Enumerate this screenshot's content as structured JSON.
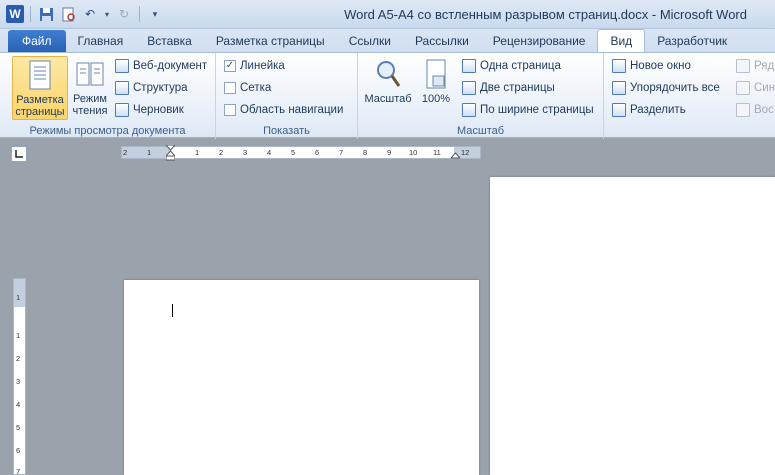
{
  "window": {
    "title": "Word A5-A4 со встленным разрывом страниц.docx  -  Microsoft Word",
    "logo_letter": "W"
  },
  "tabs": [
    {
      "label": "Файл"
    },
    {
      "label": "Главная"
    },
    {
      "label": "Вставка"
    },
    {
      "label": "Разметка страницы"
    },
    {
      "label": "Ссылки"
    },
    {
      "label": "Рассылки"
    },
    {
      "label": "Рецензирование"
    },
    {
      "label": "Вид"
    },
    {
      "label": "Разработчик"
    }
  ],
  "ribbon": {
    "view_modes": {
      "label": "Режимы просмотра документа",
      "print_layout_l1": "Разметка",
      "print_layout_l2": "страницы",
      "reading_l1": "Режим",
      "reading_l2": "чтения",
      "web": "Веб-документ",
      "outline": "Структура",
      "draft": "Черновик"
    },
    "show": {
      "label": "Показать",
      "ruler": "Линейка",
      "ruler_checked": "✓",
      "grid": "Сетка",
      "nav": "Область навигации"
    },
    "zoom": {
      "label": "Масштаб",
      "zoom_btn": "Масштаб",
      "hundred": "100%",
      "one_page": "Одна страница",
      "two_pages": "Две страницы",
      "page_width": "По ширине страницы"
    },
    "window_group": {
      "new_window": "Новое окно",
      "arrange_all": "Упорядочить все",
      "split": "Разделить",
      "side_by_side": "Ряд",
      "sync": "Син",
      "reset": "Вос"
    }
  },
  "ruler": {
    "h_ticks": [
      "2",
      "1",
      "1",
      "2",
      "3",
      "4",
      "5",
      "6",
      "7",
      "8",
      "9",
      "10",
      "11",
      "12"
    ],
    "v_ticks": [
      "1",
      "1",
      "2",
      "3",
      "4",
      "5",
      "6",
      "7"
    ]
  },
  "colors": {
    "accent_file_tab": "#2a61b4",
    "selected_button": "#fbd46b",
    "workspace": "#9aa2ac"
  }
}
